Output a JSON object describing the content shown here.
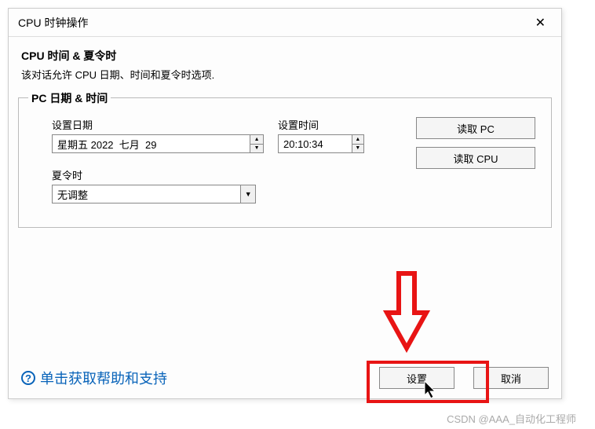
{
  "dialog": {
    "title": "CPU 时钟操作",
    "close_glyph": "✕"
  },
  "header": {
    "title": "CPU 时间 & 夏令时",
    "desc": "该对话允许 CPU 日期、时间和夏令时选项."
  },
  "fieldset": {
    "title": "PC 日期 & 时间",
    "date_label": "设置日期",
    "date_value": "星期五 2022  七月  29",
    "time_label": "设置时间",
    "time_value": "20:10:34",
    "dst_label": "夏令时",
    "dst_value": "无调整"
  },
  "buttons": {
    "read_pc": "读取 PC",
    "read_cpu": "读取 CPU",
    "ok": "设置",
    "cancel": "取消"
  },
  "help": {
    "text": "单击获取帮助和支持",
    "icon_glyph": "?"
  },
  "glyphs": {
    "up": "▲",
    "down": "▼"
  },
  "watermark": "CSDN @AAA_自动化工程师"
}
